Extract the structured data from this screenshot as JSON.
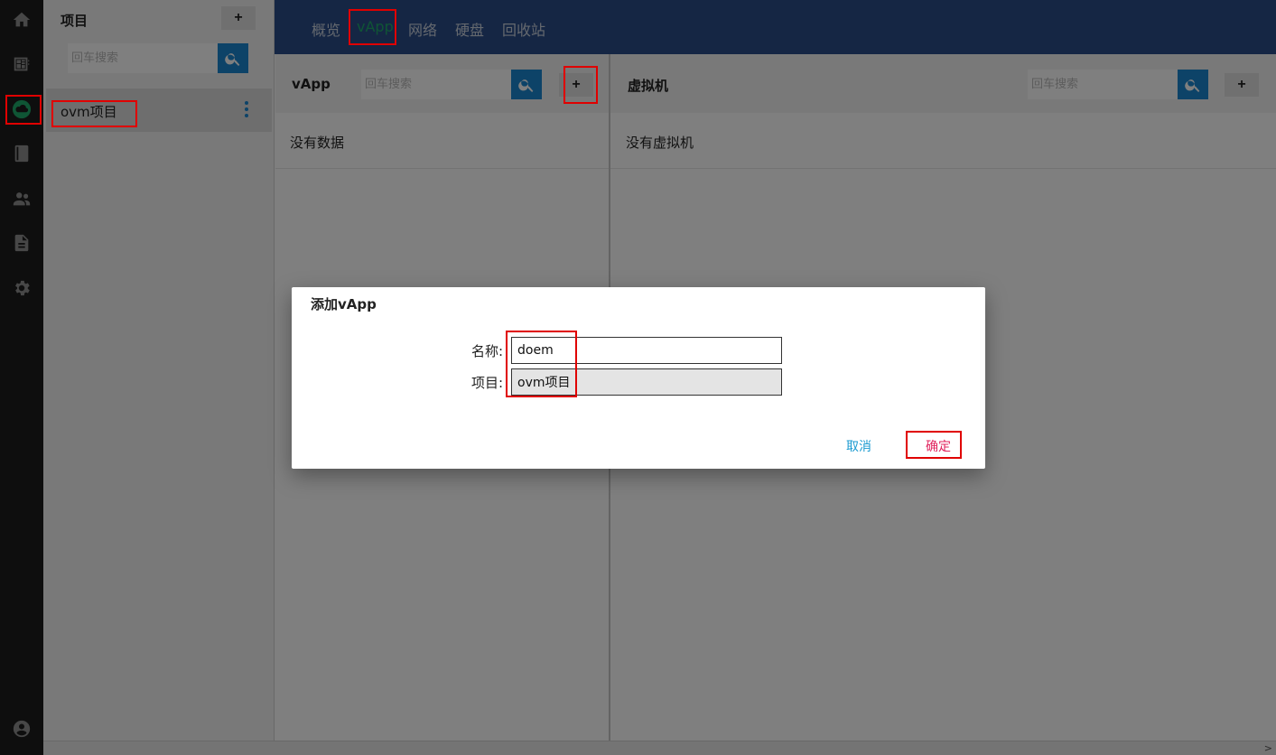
{
  "rail": {
    "icons": [
      "home-icon",
      "dashboard-icon",
      "cloud-icon",
      "book-icon",
      "users-icon",
      "document-icon",
      "gear-icon",
      "account-icon"
    ],
    "active": "cloud-icon",
    "active_color": "#1eaa6b"
  },
  "projects": {
    "title": "项目",
    "add_label": "+",
    "search_placeholder": "回车搜索",
    "items": [
      {
        "label": "ovm项目"
      }
    ]
  },
  "nav": {
    "tabs": [
      {
        "label": "概览"
      },
      {
        "label": "vApp"
      },
      {
        "label": "网络"
      },
      {
        "label": "硬盘"
      },
      {
        "label": "回收站"
      }
    ],
    "active_index": 1,
    "background": "#2a4d88"
  },
  "vapp_panel": {
    "title": "vApp",
    "search_placeholder": "回车搜索",
    "add_label": "+",
    "empty_text": "没有数据"
  },
  "vm_panel": {
    "title": "虚拟机",
    "search_placeholder": "回车搜索",
    "add_label": "+",
    "empty_text": "没有虚拟机"
  },
  "dialog": {
    "title": "添加vApp",
    "name_label": "名称:",
    "name_value": "doem",
    "project_label": "项目:",
    "project_value": "ovm项目",
    "cancel_label": "取消",
    "ok_label": "确定",
    "cancel_color": "#1a9ad0",
    "ok_color": "#e0245e"
  },
  "scrollbar": {
    "arrow": ">"
  }
}
